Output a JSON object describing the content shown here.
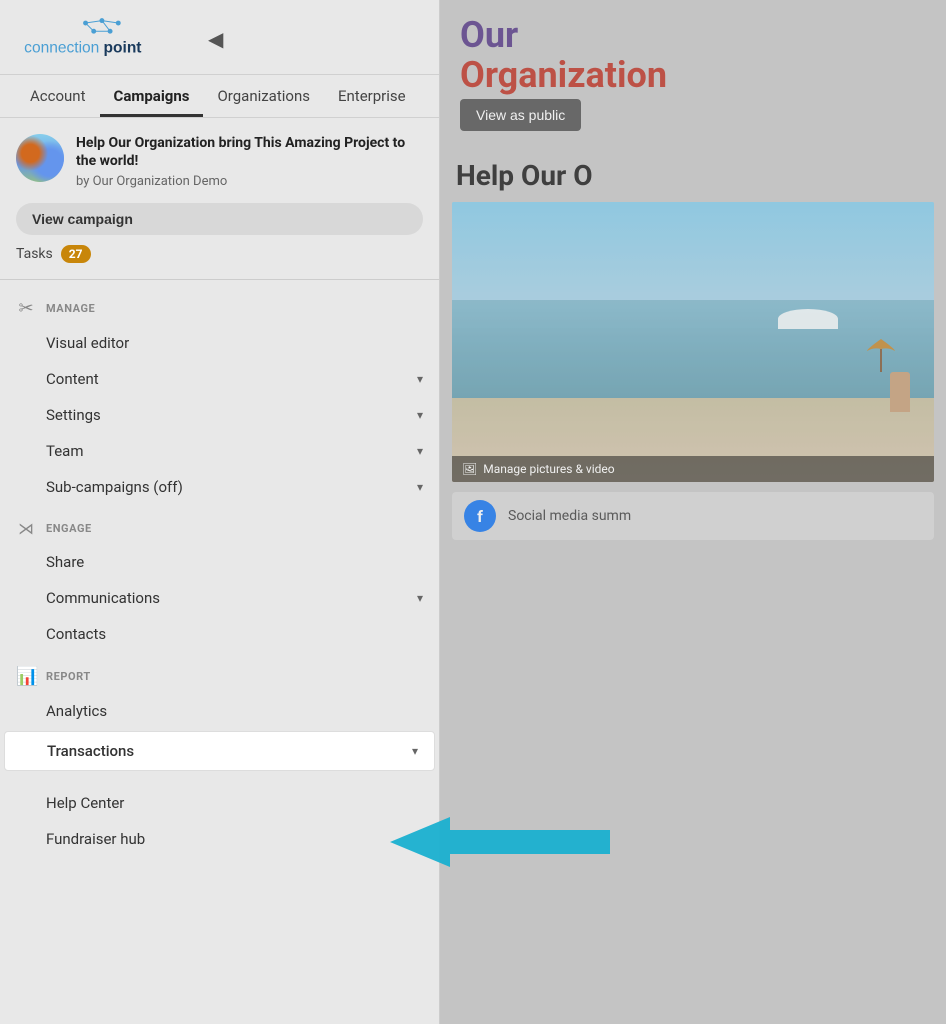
{
  "app": {
    "name": "connectionpoint"
  },
  "header": {
    "collapse_btn": "◀"
  },
  "top_nav": {
    "items": [
      {
        "id": "account",
        "label": "Account",
        "active": false
      },
      {
        "id": "campaigns",
        "label": "Campaigns",
        "active": true
      },
      {
        "id": "organizations",
        "label": "Organizations",
        "active": false
      },
      {
        "id": "enterprise",
        "label": "Enterprise",
        "active": false
      }
    ]
  },
  "campaign": {
    "title": "Help Our Organization bring This Amazing Project to the world!",
    "org": "by Our Organization Demo",
    "view_btn": "View campaign",
    "tasks_label": "Tasks",
    "tasks_count": "27"
  },
  "manage_section": {
    "label": "MANAGE",
    "items": [
      {
        "label": "Visual editor",
        "has_chevron": false
      },
      {
        "label": "Content",
        "has_chevron": true
      },
      {
        "label": "Settings",
        "has_chevron": true
      },
      {
        "label": "Team",
        "has_chevron": true
      },
      {
        "label": "Sub-campaigns (off)",
        "has_chevron": true
      }
    ]
  },
  "engage_section": {
    "label": "ENGAGE",
    "items": [
      {
        "label": "Share",
        "has_chevron": false
      },
      {
        "label": "Communications",
        "has_chevron": true
      },
      {
        "label": "Contacts",
        "has_chevron": false
      }
    ]
  },
  "report_section": {
    "label": "REPORT",
    "items": [
      {
        "label": "Analytics",
        "has_chevron": false
      },
      {
        "label": "Transactions",
        "has_chevron": true,
        "highlighted": true
      }
    ]
  },
  "bottom_links": [
    {
      "label": "Help Center"
    },
    {
      "label": "Fundraiser hub"
    }
  ],
  "right_panel": {
    "org_our": "Our",
    "org_organization": "Organization",
    "view_as_public": "View as public",
    "help_title": "Help Our O",
    "manage_pictures": "Manage pictures & video",
    "social_text": "Social media summ"
  },
  "colors": {
    "tasks_badge": "#c8860a",
    "org_our": "#5a3e8a",
    "org_organization": "#c0392b",
    "facebook": "#1877F2",
    "arrow": "#1ab0d0"
  }
}
